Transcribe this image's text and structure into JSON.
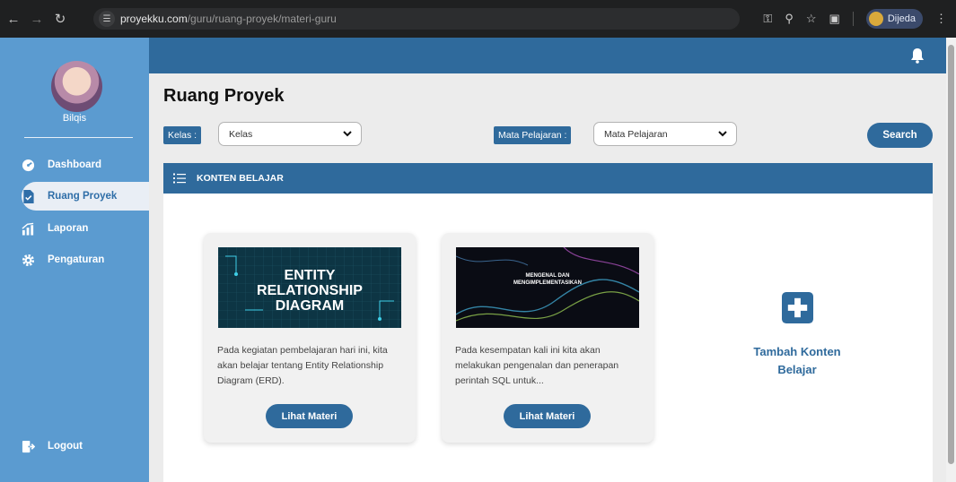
{
  "browser": {
    "url_host": "proyekku.com",
    "url_path": "/guru/ruang-proyek/materi-guru",
    "profile_name": "Dijeda"
  },
  "user": {
    "name": "Bilqis"
  },
  "sidebar": {
    "items": [
      {
        "label": "Dashboard",
        "icon": "gauge-icon"
      },
      {
        "label": "Ruang Proyek",
        "icon": "document-icon",
        "active": true
      },
      {
        "label": "Laporan",
        "icon": "chart-icon"
      },
      {
        "label": "Pengaturan",
        "icon": "gear-icon"
      }
    ],
    "logout_label": "Logout"
  },
  "page": {
    "title": "Ruang Proyek",
    "filters": {
      "kelas_label": "Kelas :",
      "kelas_value": "Kelas",
      "mapel_label": "Mata Pelajaran :",
      "mapel_value": "Mata Pelajaran",
      "search_label": "Search"
    },
    "panel_title": "KONTEN BELAJAR"
  },
  "cards": [
    {
      "thumb_lines": [
        "ENTITY",
        "RELATIONSHIP",
        "DIAGRAM"
      ],
      "description": "Pada kegiatan pembelajaran hari ini, kita akan belajar tentang Entity Relationship Diagram (ERD).",
      "button_label": "Lihat Materi"
    },
    {
      "thumb_lines": [
        "MENGENAL DAN",
        "MENGIMPLEMENTASIKAN"
      ],
      "description": "Pada kesempatan kali ini kita akan melakukan pengenalan dan penerapan perintah SQL untuk...",
      "button_label": "Lihat Materi"
    }
  ],
  "add_content": {
    "line1": "Tambah Konten",
    "line2": "Belajar"
  },
  "colors": {
    "primary": "#2f6a9c",
    "sidebar": "#5b9bd0",
    "background": "#ececec"
  }
}
